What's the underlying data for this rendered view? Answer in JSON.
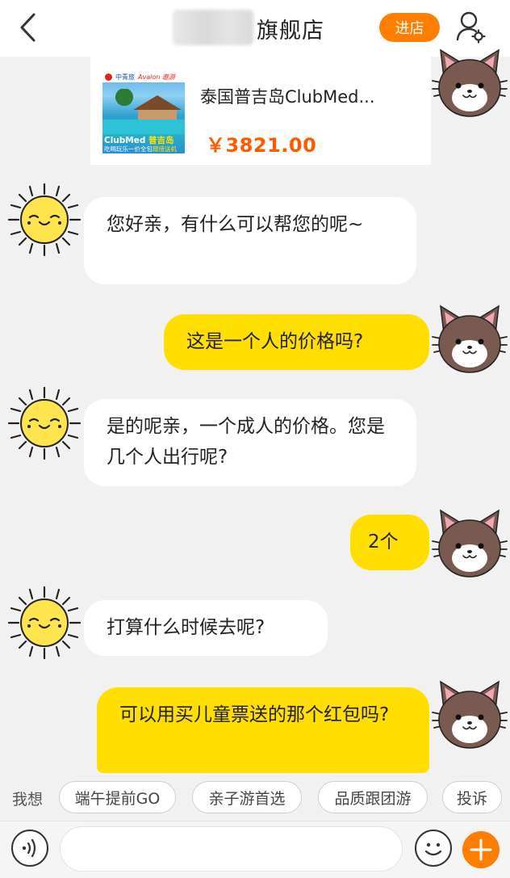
{
  "header": {
    "store_name_suffix": "旗舰店",
    "enter_store_label": "进店",
    "colors": {
      "accent": "#ff7e00",
      "background": "#ffffff"
    }
  },
  "product": {
    "name": "泰国普吉岛ClubMed...",
    "price": "￥3821.00",
    "thumbnail": {
      "brand": "中青旅",
      "brand2": "Avalon 遨游",
      "line1_a": "ClubMed",
      "line1_b": "普吉岛",
      "line2_a": "吃喝玩乐一价全包",
      "line2_b": "赠接送机"
    }
  },
  "messages": [
    {
      "sender": "agent",
      "text": "您好亲，有什么可以帮您的呢~"
    },
    {
      "sender": "user",
      "text": "这是一个人的价格吗?"
    },
    {
      "sender": "agent",
      "text": "是的呢亲，一个成人的价格。您是几个人出行呢?"
    },
    {
      "sender": "user",
      "text": "2个"
    },
    {
      "sender": "agent",
      "text": "打算什么时候去呢?"
    },
    {
      "sender": "user",
      "text": "可以用买儿童票送的那个红包吗?"
    }
  ],
  "quick_replies": {
    "label": "我想",
    "items": [
      "端午提前GO",
      "亲子游首选",
      "品质跟团游",
      "投诉"
    ]
  },
  "input_bar": {
    "placeholder": "",
    "icons": [
      "voice-icon",
      "emoji-icon",
      "plus-icon"
    ]
  },
  "colors": {
    "agent_bubble": "#ffffff",
    "user_bubble": "#ffde00",
    "price": "#ff5a00",
    "page_background": "#f1f1f1"
  }
}
